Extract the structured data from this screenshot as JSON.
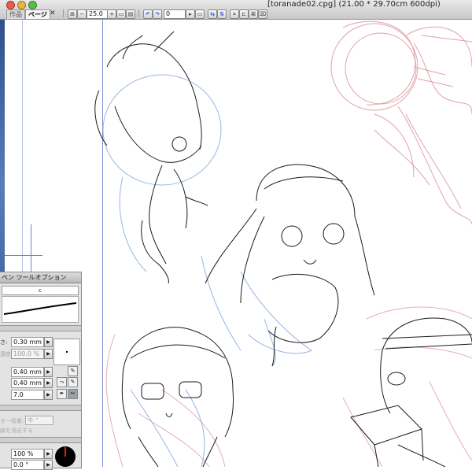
{
  "window": {
    "title": "[toranade02.cpg] (21.00 * 29.70cm 600dpi)"
  },
  "tabs": [
    {
      "label": "作品"
    },
    {
      "label": "ページ"
    }
  ],
  "toolbar": {
    "zoom_value": "25.0",
    "rotation_value": "0"
  },
  "palette": {
    "title": "ペン ツールオプション",
    "preset": "c",
    "size_label": "さ:",
    "size_value": "0.30 mm",
    "density_label": "濃度:",
    "density_value": "100.0 %",
    "in_value": "0.40 mm",
    "out_value": "0.40 mm",
    "correction_value": "7.0",
    "absorb_label": "ター吸着:",
    "absorb_value": "中",
    "erase_label": "線を消去する",
    "scale_value": "100 %",
    "angle_value": "0.0 °"
  },
  "colors": {
    "guide": "#7f8fd6",
    "sketch_red": "#d98c94",
    "sketch_blue": "#7ea4d8",
    "ink": "#1a1a1a"
  }
}
